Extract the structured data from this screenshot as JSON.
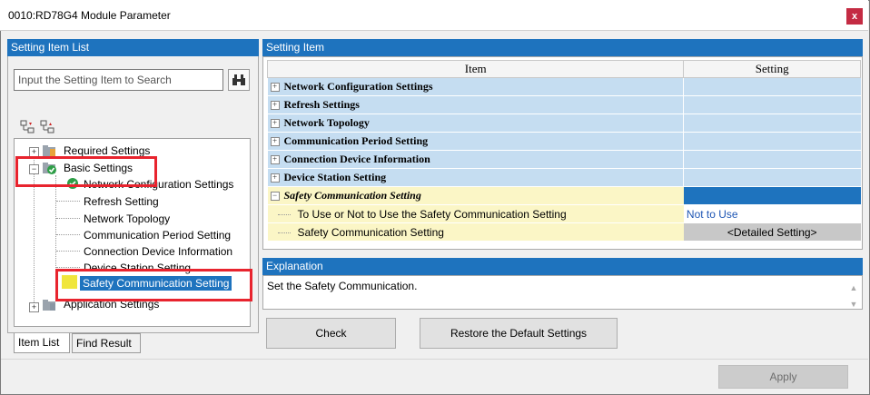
{
  "window": {
    "title": "0010:RD78G4 Module Parameter",
    "close_glyph": "x"
  },
  "left": {
    "header": "Setting Item List",
    "search_placeholder": "Input the Setting Item to Search",
    "tree": {
      "required": "Required Settings",
      "basic": "Basic Settings",
      "basic_children": [
        "Network Configuration Settings",
        "Refresh Setting",
        "Network Topology",
        "Communication Period Setting",
        "Connection Device Information",
        "Device Station Setting",
        "Safety Communication Setting"
      ],
      "application": "Application Settings"
    },
    "tabs": [
      "Item List",
      "Find Result"
    ]
  },
  "right": {
    "header": "Setting Item",
    "columns": [
      "Item",
      "Setting"
    ],
    "rows": [
      {
        "label": "Network Configuration Settings",
        "value": ""
      },
      {
        "label": "Refresh Settings",
        "value": ""
      },
      {
        "label": "Network Topology",
        "value": ""
      },
      {
        "label": "Communication Period Setting",
        "value": ""
      },
      {
        "label": "Connection Device Information",
        "value": ""
      },
      {
        "label": "Device Station Setting",
        "value": ""
      },
      {
        "label": "Safety Communication Setting",
        "value": ""
      }
    ],
    "subrows": [
      {
        "label": "To Use or Not to Use the Safety Communication Setting",
        "value": "Not to Use"
      },
      {
        "label": "Safety Communication Setting",
        "value": "<Detailed Setting>"
      }
    ],
    "explanation_header": "Explanation",
    "explanation_text": "Set the Safety Communication.",
    "buttons": {
      "check": "Check",
      "restore": "Restore the Default Settings",
      "apply": "Apply"
    }
  },
  "colors": {
    "header_blue": "#1e73be",
    "section_blue": "#c5ddf1",
    "sub_yellow": "#fbf6c6",
    "highlight_red": "#e8242e",
    "close_red": "#c42b43"
  }
}
